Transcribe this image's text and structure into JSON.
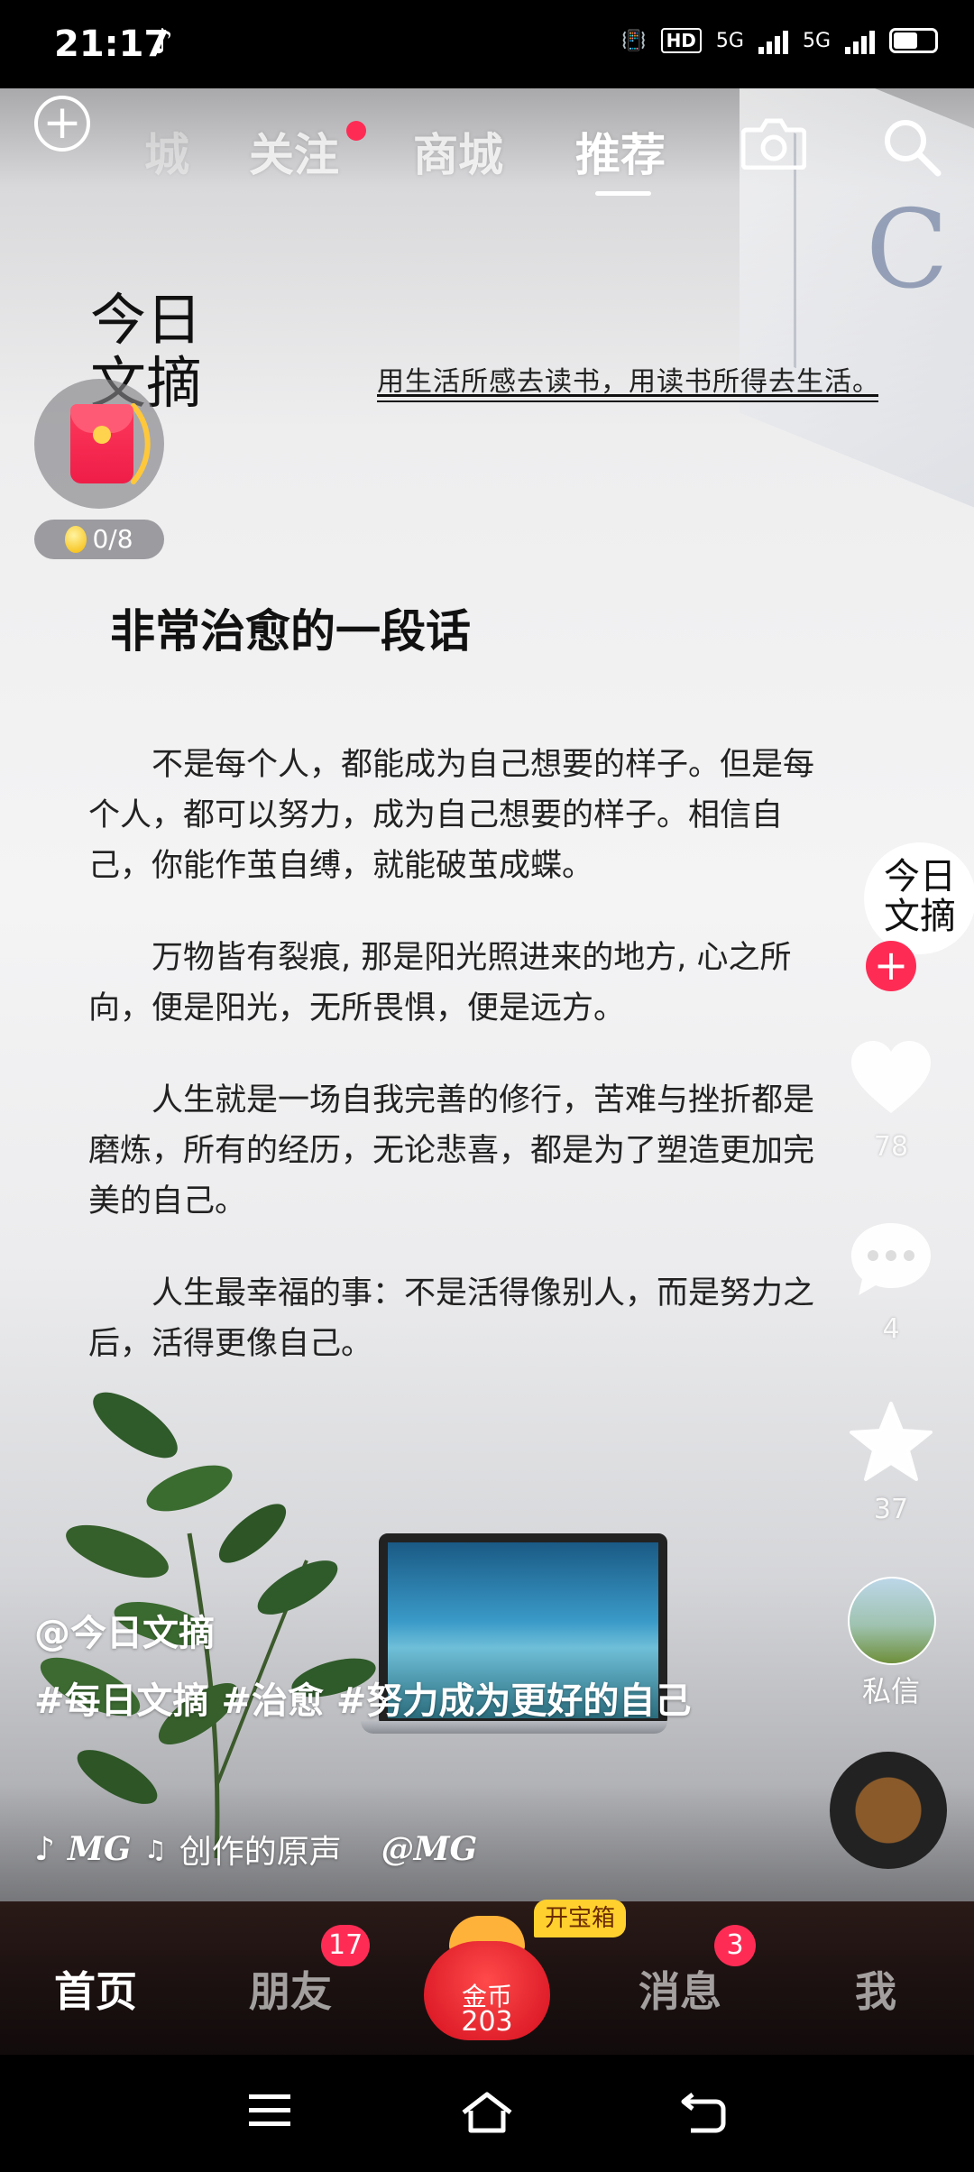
{
  "status_bar": {
    "time": "21:17",
    "network_labels": [
      "HD",
      "5G",
      "5G"
    ]
  },
  "top_nav": {
    "tabs": [
      {
        "label": "城"
      },
      {
        "label": "关注"
      },
      {
        "label": "商城"
      },
      {
        "label": "推荐"
      }
    ],
    "active_tab": "推荐"
  },
  "post": {
    "brand_logo": "今日\n文摘",
    "motto": "用生活所感去读书，用读书所得去生活。",
    "title": "非常治愈的一段话",
    "paragraphs": [
      "不是每个人，都能成为自己想要的样子。但是每个人，都可以努力，成为自己想要的样子。相信自己，你能作茧自缚，就能破茧成蝶。",
      "万物皆有裂痕, 那是阳光照进来的地方, 心之所向，便是阳光，无所畏惧，便是远方。",
      "人生就是一场自我完善的修行，苦难与挫折都是磨炼，所有的经历，无论悲喜，都是为了塑造更加完美的自己。",
      "人生最幸福的事：不是活得像别人，而是努力之后，活得更像自己。"
    ],
    "author": "@今日文摘",
    "hashtags": "#每日文摘 #治愈 #努力成为更好的自己",
    "music_logo_text": "MG",
    "music_title": "创作的原声",
    "music_author": "@MG"
  },
  "reward": {
    "progress": "0/8"
  },
  "rail": {
    "avatar_text_line1": "今日",
    "avatar_text_line2": "文摘",
    "likes": "78",
    "comments": "4",
    "favorites": "37",
    "dm_label": "私信"
  },
  "bottom_nav": {
    "home": "首页",
    "friends": "朋友",
    "friends_badge": "17",
    "coin_label": "金币",
    "coin_count": "203",
    "treasure_label": "开宝箱",
    "messages": "消息",
    "messages_badge": "3",
    "me": "我"
  },
  "colors": {
    "accent": "#fe2c55",
    "gold": "#ffd02e"
  }
}
